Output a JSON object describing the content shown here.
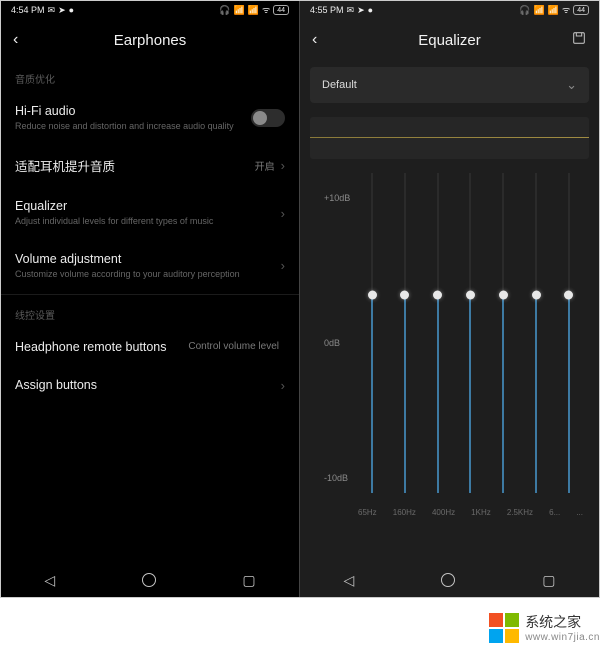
{
  "left": {
    "statusbar": {
      "time": "4:54 PM",
      "battery": "44"
    },
    "header": {
      "title": "Earphones"
    },
    "section1": "音质优化",
    "hifi": {
      "title": "Hi-Fi audio",
      "sub": "Reduce noise and distortion and increase audio quality"
    },
    "adapt": {
      "title": "适配耳机提升音质",
      "value": "开启"
    },
    "eq": {
      "title": "Equalizer",
      "sub": "Adjust individual levels for different types of music"
    },
    "vol": {
      "title": "Volume adjustment",
      "sub": "Customize volume according to your auditory perception"
    },
    "section2": "线控设置",
    "remote": {
      "title": "Headphone remote buttons",
      "value": "Control volume level"
    },
    "assign": {
      "title": "Assign buttons"
    }
  },
  "right": {
    "statusbar": {
      "time": "4:55 PM",
      "battery": "44"
    },
    "header": {
      "title": "Equalizer"
    },
    "preset": "Default",
    "axis": {
      "top": "+10dB",
      "mid": "0dB",
      "bot": "-10dB"
    },
    "freqs": [
      "65Hz",
      "160Hz",
      "400Hz",
      "1KHz",
      "2.5KHz",
      "6...",
      "..."
    ]
  },
  "watermark": {
    "brand": "系统之家",
    "url": "www.win7jia.cn"
  }
}
